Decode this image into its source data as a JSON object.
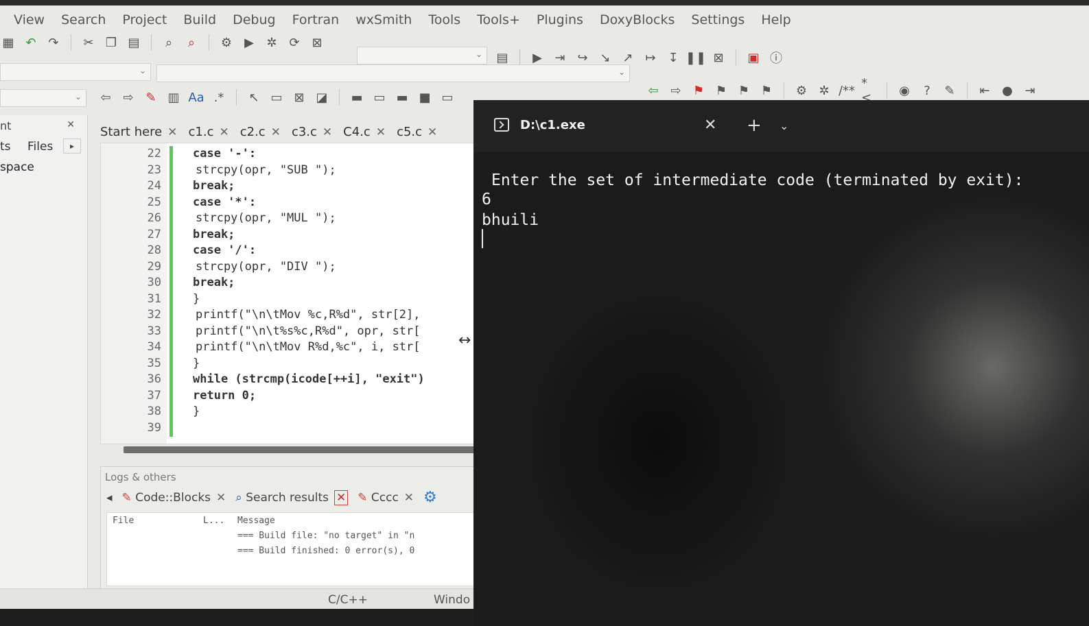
{
  "ide": {
    "menu": [
      "View",
      "Search",
      "Project",
      "Build",
      "Debug",
      "Fortran",
      "wxSmith",
      "Tools",
      "Tools+",
      "Plugins",
      "DoxyBlocks",
      "Settings",
      "Help"
    ],
    "management": {
      "title": "nt",
      "tab_a": "ts",
      "tab_b": "Files",
      "workspace": "space"
    },
    "editor_tabs": [
      {
        "label": "Start here"
      },
      {
        "label": "c1.c"
      },
      {
        "label": "c2.c"
      },
      {
        "label": "c3.c"
      },
      {
        "label": "C4.c"
      },
      {
        "label": "c5.c"
      }
    ],
    "code_lines": [
      {
        "num": "22",
        "text": "case '-':"
      },
      {
        "num": "23",
        "text": "strcpy(opr, \"SUB \");"
      },
      {
        "num": "24",
        "text": "break;"
      },
      {
        "num": "25",
        "text": "case '*':"
      },
      {
        "num": "26",
        "text": "strcpy(opr, \"MUL \");"
      },
      {
        "num": "27",
        "text": "break;"
      },
      {
        "num": "28",
        "text": "case '/':"
      },
      {
        "num": "29",
        "text": "strcpy(opr, \"DIV \");"
      },
      {
        "num": "30",
        "text": "break;"
      },
      {
        "num": "31",
        "text": "}"
      },
      {
        "num": "32",
        "text": "printf(\"\\n\\tMov %c,R%d\", str[2],"
      },
      {
        "num": "33",
        "text": "printf(\"\\n\\t%s%c,R%d\", opr, str["
      },
      {
        "num": "34",
        "text": "printf(\"\\n\\tMov R%d,%c\", i, str["
      },
      {
        "num": "35",
        "text": "}"
      },
      {
        "num": "36",
        "text": "while (strcmp(icode[++i], \"exit\")"
      },
      {
        "num": "37",
        "text": "return 0;"
      },
      {
        "num": "38",
        "text": "}"
      },
      {
        "num": "39",
        "text": ""
      }
    ],
    "logs": {
      "header": "Logs & others",
      "tabs": [
        {
          "label": "Code::Blocks"
        },
        {
          "label": "Search results"
        },
        {
          "label": "Cccc"
        }
      ],
      "columns": [
        "File",
        "L...",
        "Message"
      ],
      "messages": [
        "=== Build file: \"no target\" in \"n",
        "=== Build finished: 0 error(s), 0"
      ]
    },
    "status": {
      "language": "C/C++",
      "eol": "Windo"
    }
  },
  "terminal": {
    "title": "D:\\c1.exe",
    "lines": [
      "Enter the set of intermediate code (terminated by exit):",
      "6",
      "bhuili"
    ]
  },
  "colors": {
    "terminal_bg": "#1b1b1b",
    "ide_bg": "#e9e9e6",
    "change_bar": "#5cc85c"
  }
}
